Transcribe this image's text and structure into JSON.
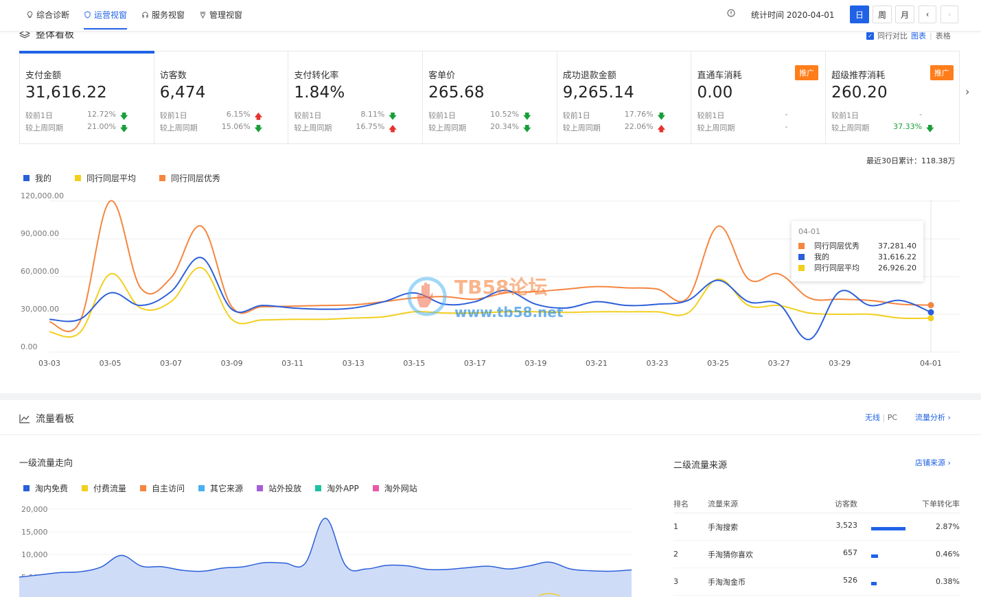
{
  "topbar": {
    "tabs": [
      {
        "label": "综合诊断",
        "icon": "bulb-icon"
      },
      {
        "label": "运营视窗",
        "icon": "shield-icon"
      },
      {
        "label": "服务视窗",
        "icon": "headset-icon"
      },
      {
        "label": "管理视窗",
        "icon": "tie-icon"
      }
    ],
    "active_tab": 1,
    "stat_time": "统计时间 2020-04-01",
    "periods": [
      "日",
      "周",
      "月"
    ],
    "active_period": 0,
    "prev": "‹",
    "next": "›"
  },
  "overview": {
    "title": "整体看板",
    "compare_label": "同行对比",
    "view_chart": "图表",
    "view_sep": "|",
    "view_table": "表格",
    "metrics": [
      {
        "label": "支付金额",
        "value": "31,616.22",
        "day_label": "较前1日",
        "day": "12.72%",
        "day_dir": "down",
        "week_label": "较上周同期",
        "week": "21.00%",
        "week_dir": "down"
      },
      {
        "label": "访客数",
        "value": "6,474",
        "day_label": "较前1日",
        "day": "6.15%",
        "day_dir": "up",
        "week_label": "较上周同期",
        "week": "15.06%",
        "week_dir": "down"
      },
      {
        "label": "支付转化率",
        "value": "1.84%",
        "day_label": "较前1日",
        "day": "8.11%",
        "day_dir": "down",
        "week_label": "较上周同期",
        "week": "16.75%",
        "week_dir": "up"
      },
      {
        "label": "客单价",
        "value": "265.68",
        "day_label": "较前1日",
        "day": "10.52%",
        "day_dir": "down",
        "week_label": "较上周同期",
        "week": "20.34%",
        "week_dir": "down"
      },
      {
        "label": "成功退款金额",
        "value": "9,265.14",
        "day_label": "较前1日",
        "day": "17.76%",
        "day_dir": "down",
        "week_label": "较上周同期",
        "week": "22.06%",
        "week_dir": "up"
      },
      {
        "label": "直通车消耗",
        "value": "0.00",
        "day_label": "较前1日",
        "day": "-",
        "day_dir": "",
        "week_label": "较上周同期",
        "week": "-",
        "week_dir": "",
        "promo": "推广"
      },
      {
        "label": "超级推荐消耗",
        "value": "260.20",
        "day_label": "较前1日",
        "day": "-",
        "day_dir": "",
        "week_label": "较上周同期",
        "week": "37.33%",
        "week_dir": "down",
        "promo": "推广"
      }
    ],
    "cumulative": "最近30日累计：118.38万",
    "colors": {
      "mine": "#2b5fd9",
      "avg": "#f2cf1d",
      "best": "#f5853f"
    }
  },
  "chart_data": [
    {
      "type": "line",
      "title": "",
      "x": [
        "03-03",
        "03-04",
        "03-05",
        "03-06",
        "03-07",
        "03-08",
        "03-09",
        "03-10",
        "03-11",
        "03-12",
        "03-13",
        "03-14",
        "03-15",
        "03-16",
        "03-17",
        "03-18",
        "03-19",
        "03-20",
        "03-21",
        "03-22",
        "03-23",
        "03-24",
        "03-25",
        "03-26",
        "03-27",
        "03-28",
        "03-29",
        "03-30",
        "03-31",
        "04-01"
      ],
      "x_ticks": [
        "03-03",
        "03-05",
        "03-07",
        "03-09",
        "03-11",
        "03-13",
        "03-15",
        "03-17",
        "03-19",
        "03-21",
        "03-23",
        "03-25",
        "03-27",
        "03-29",
        "04-01"
      ],
      "y_ticks": [
        "120,000.00",
        "90,000.00",
        "60,000.00",
        "30,000.00",
        "0.00"
      ],
      "ylim": [
        0,
        120000
      ],
      "legend_position": "top-left",
      "series": [
        {
          "name": "我的",
          "values": [
            26000,
            26000,
            47000,
            37000,
            48000,
            75000,
            34000,
            37000,
            35000,
            34000,
            35000,
            40000,
            47000,
            38000,
            40000,
            49000,
            38000,
            35000,
            40000,
            37000,
            38000,
            41000,
            57000,
            40000,
            38000,
            10000,
            48000,
            37000,
            41000,
            31616
          ]
        },
        {
          "name": "同行同层平均",
          "values": [
            16000,
            15500,
            62000,
            35000,
            40000,
            67000,
            26000,
            25500,
            26000,
            26000,
            27000,
            28000,
            32000,
            31000,
            31000,
            32000,
            32000,
            31500,
            32000,
            32000,
            32000,
            31000,
            58000,
            37000,
            37000,
            31000,
            30000,
            30000,
            27000,
            26926
          ]
        },
        {
          "name": "同行同层优秀",
          "values": [
            24000,
            24000,
            120000,
            51000,
            59000,
            100000,
            36000,
            36000,
            36500,
            37000,
            37500,
            40000,
            43000,
            44000,
            42000,
            47000,
            48000,
            50000,
            52000,
            51000,
            50000,
            43000,
            100000,
            58000,
            62000,
            43000,
            42000,
            41000,
            38000,
            37281
          ]
        }
      ],
      "tooltip": {
        "date": "04-01",
        "rows": [
          {
            "name": "同行同层优秀",
            "value": "37,281.40",
            "color": "#f5853f"
          },
          {
            "name": "我的",
            "value": "31,616.22",
            "color": "#2b5fd9"
          },
          {
            "name": "同行同层平均",
            "value": "26,926.20",
            "color": "#f2cf1d"
          }
        ]
      }
    },
    {
      "type": "area",
      "title": "一级流量走向",
      "y_ticks": [
        "20,000",
        "15,000",
        "10,000",
        "5,000"
      ],
      "ylim": [
        0,
        20000
      ],
      "legend_position": "top-left",
      "series": [
        {
          "name": "淘内免费",
          "color": "#2b5fd9",
          "values": [
            5000,
            5500,
            6000,
            6200,
            7200,
            9800,
            7400,
            7300,
            6500,
            6300,
            7000,
            7300,
            8200,
            8100,
            8000,
            18000,
            7500,
            6800,
            7600,
            7500,
            6700,
            6700,
            7100,
            7400,
            6800,
            7500,
            8300,
            6800,
            6400,
            6300,
            6600
          ]
        },
        {
          "name": "付费流量",
          "color": "#f2cf1d",
          "values": []
        },
        {
          "name": "自主访问",
          "color": "#f5853f",
          "values": []
        },
        {
          "name": "其它来源",
          "color": "#4ab0f0",
          "values": []
        },
        {
          "name": "站外投放",
          "color": "#a35ddb",
          "values": []
        },
        {
          "name": "淘外APP",
          "color": "#1fc2a0",
          "values": []
        },
        {
          "name": "淘外网站",
          "color": "#e85aa6",
          "values": []
        }
      ]
    }
  ],
  "traffic": {
    "title": "流量看板",
    "wireless": "无线",
    "sep": "|",
    "pc": "PC",
    "analysis_link": "流量分析 ›",
    "first_level_title": "一级流量走向",
    "second_level_title": "二级流量来源",
    "shop_source_link": "店铺来源 ›",
    "table": {
      "headers": [
        "排名",
        "流量来源",
        "访客数",
        "下单转化率"
      ],
      "rows": [
        {
          "rank": "1",
          "source": "手淘搜索",
          "visitors": "3,523",
          "share": 1.0,
          "conv": "2.87%"
        },
        {
          "rank": "2",
          "source": "手淘猜你喜欢",
          "visitors": "657",
          "share": 0.19,
          "conv": "0.46%"
        },
        {
          "rank": "3",
          "source": "手淘淘金币",
          "visitors": "526",
          "share": 0.15,
          "conv": "0.38%"
        }
      ]
    }
  },
  "watermark": {
    "line1": "TB58论坛",
    "line2": "www.tb58.net"
  }
}
